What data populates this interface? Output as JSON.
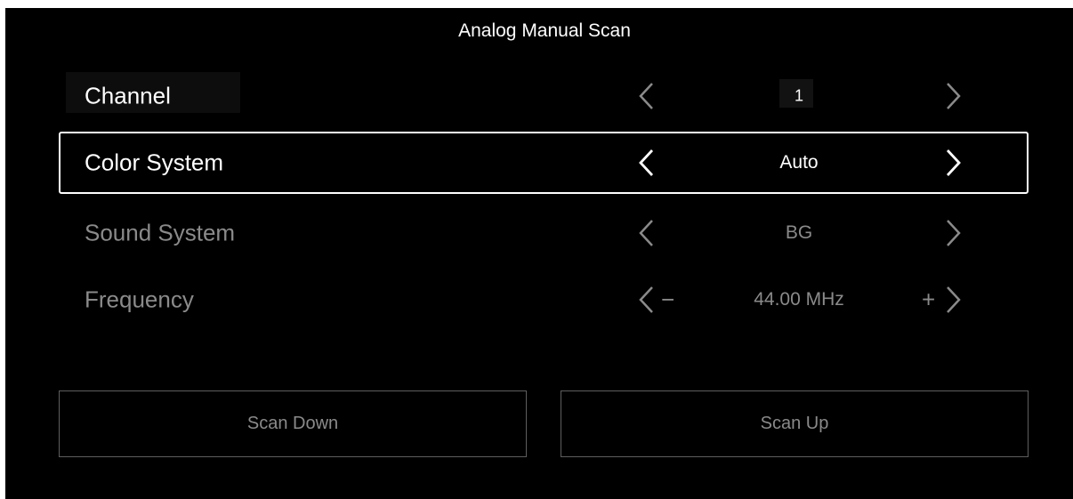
{
  "title": "Analog Manual Scan",
  "rows": [
    {
      "label": "Channel",
      "value": "1"
    },
    {
      "label": "Color System",
      "value": "Auto"
    },
    {
      "label": "Sound System",
      "value": "BG"
    },
    {
      "label": "Frequency",
      "value": "44.00 MHz",
      "decrement_symbol": "−",
      "increment_symbol": "+"
    }
  ],
  "focused_row": "Color System",
  "buttons": {
    "scan_down": "Scan Down",
    "scan_up": "Scan Up"
  },
  "colors": {
    "background": "#000000",
    "text_active": "#ffffff",
    "text_inactive": "#8a8a8a",
    "border_inactive": "#5e5e5e"
  }
}
